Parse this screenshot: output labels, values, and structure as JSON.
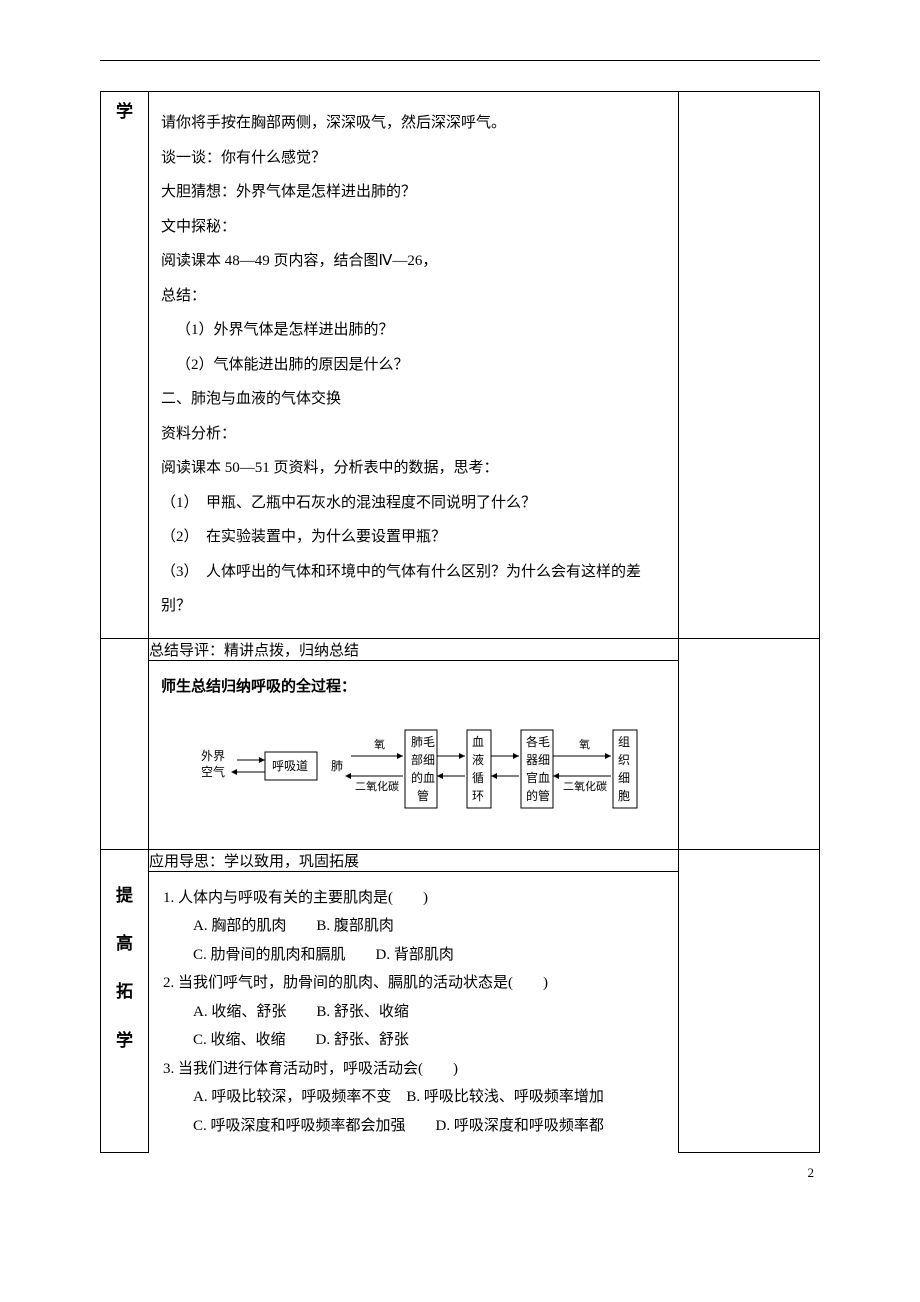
{
  "sidebar1": {
    "char": "学"
  },
  "section1": {
    "p1": "请你将手按在胸部两侧，深深吸气，然后深深呼气。",
    "p2": "谈一谈：你有什么感觉？",
    "p3": "大胆猜想：外界气体是怎样进出肺的？",
    "p4": "文中探秘：",
    "p5": "阅读课本 48—49 页内容，结合图Ⅳ—26，",
    "p6": "总结：",
    "p7": "（1）外界气体是怎样进出肺的？",
    "p8": "（2）气体能进出肺的原因是什么？",
    "h2": "二、肺泡与血液的气体交换",
    "p9": "资料分析：",
    "p10": "阅读课本 50—51 页资料，分析表中的数据，思考：",
    "q1n": "（1）",
    "q1": "甲瓶、乙瓶中石灰水的混浊程度不同说明了什么？",
    "q2n": "（2）",
    "q2": "在实验装置中，为什么要设置甲瓶？",
    "q3n": "（3）",
    "q3": "人体呼出的气体和环境中的气体有什么区别？为什么会有这样的差别？"
  },
  "section2": {
    "head": "总结导评：精讲点拨，归纳总结",
    "title": "师生总结归纳呼吸的全过程："
  },
  "diagram": {
    "n1a": "外界",
    "n1b": "空气",
    "n2": "呼吸道",
    "n3": "肺",
    "n4a": "肺毛",
    "n4b": "部细",
    "n4c": "的血",
    "n4d": "管",
    "n5a": "血",
    "n5b": "液",
    "n5c": "循",
    "n5d": "环",
    "n6a": "各毛",
    "n6b": "器细",
    "n6c": "官血",
    "n6d": "的管",
    "n7a": "组",
    "n7b": "织",
    "n7c": "细",
    "n7d": "胞",
    "lab1": "氧",
    "lab2": "二氧化碳",
    "lab3": "氧",
    "lab4": "二氧化碳"
  },
  "section3": {
    "head": "应用导思：学以致用，巩固拓展"
  },
  "sidebar2": {
    "c1": "提",
    "c2": "高",
    "c3": "拓",
    "c4": "学"
  },
  "quiz": {
    "q1": "1. 人体内与呼吸有关的主要肌肉是(　　)",
    "q1a": "A. 胸部的肌肉　　B. 腹部肌肉",
    "q1b": "C. 肋骨间的肌肉和膈肌　　D. 背部肌肉",
    "q2": "2. 当我们呼气时，肋骨间的肌肉、膈肌的活动状态是(　　)",
    "q2a": "A. 收缩、舒张　　B. 舒张、收缩",
    "q2b": "C. 收缩、收缩　　D. 舒张、舒张",
    "q3": "3. 当我们进行体育活动时，呼吸活动会(　　)",
    "q3a": "A. 呼吸比较深，呼吸频率不变　B. 呼吸比较浅、呼吸频率增加",
    "q3b": "C. 呼吸深度和呼吸频率都会加强　　D. 呼吸深度和呼吸频率都"
  },
  "pagenum": "2"
}
